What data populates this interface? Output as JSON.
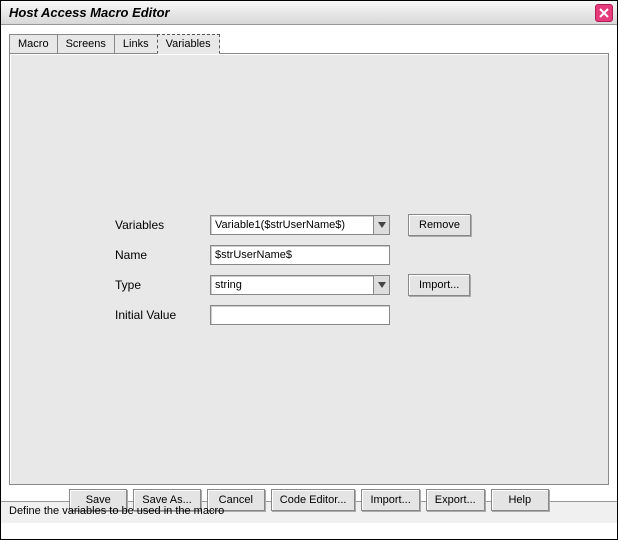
{
  "window": {
    "title": "Host Access Macro Editor"
  },
  "tabs": {
    "items": [
      {
        "label": "Macro"
      },
      {
        "label": "Screens"
      },
      {
        "label": "Links"
      },
      {
        "label": "Variables"
      }
    ]
  },
  "form": {
    "variables_label": "Variables",
    "variables_value": "Variable1($strUserName$)",
    "remove_label": "Remove",
    "name_label": "Name",
    "name_value": "$strUserName$",
    "type_label": "Type",
    "type_value": "string",
    "import_label": "Import...",
    "initial_label": "Initial Value",
    "initial_value": ""
  },
  "buttons": {
    "save": "Save",
    "save_as": "Save As...",
    "cancel": "Cancel",
    "code_editor": "Code Editor...",
    "import": "Import...",
    "export": "Export...",
    "help": "Help"
  },
  "status": {
    "text": "Define the variables to be used in the macro"
  }
}
